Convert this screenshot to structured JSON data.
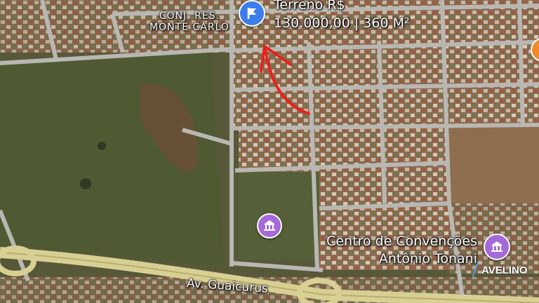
{
  "map": {
    "neighborhood_label_line1": "CONJ. RES.",
    "neighborhood_label_line2": "MONTE CARLO",
    "listing_title": "Terreno R$",
    "listing_details": "130.000,00 | 360 M²",
    "street_label": "Av. Guaicurus",
    "poi_label_line1": "Centro de Convenções",
    "poi_label_line2": "Antônio Tonani",
    "watermark": "AVELINO",
    "colors": {
      "road": "#b9b7b2",
      "highway": "#d8cf92",
      "pin_blue": "#3b7ded",
      "poi_purple": "#a56ad8",
      "arrow": "#e8221f",
      "edge_marker": "#f08a2a"
    },
    "icons": {
      "listing_pin": "flag-icon",
      "poi_pin": "landmark-icon",
      "edge_marker": "partial-marker-icon"
    }
  }
}
